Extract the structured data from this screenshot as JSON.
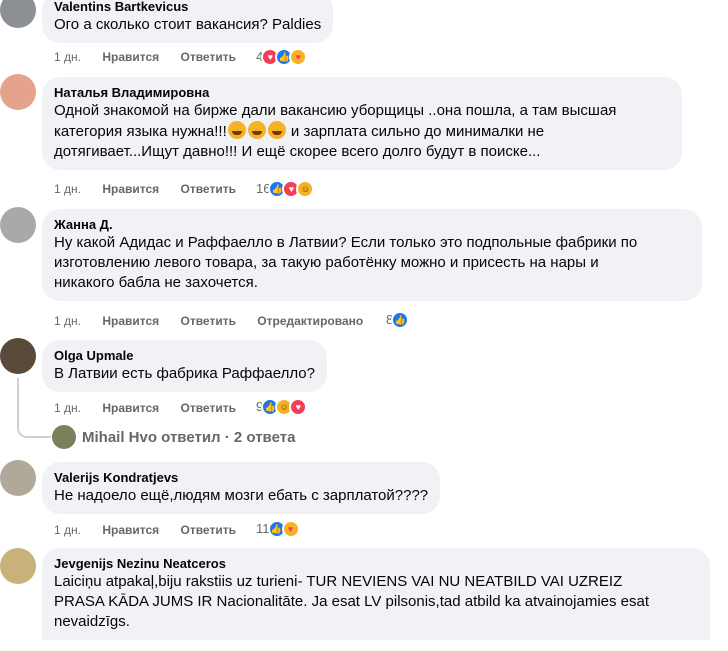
{
  "comments": [
    {
      "author": "Valentins Bartkevicus",
      "text": "Ого а сколько стоит вакансия? Paldies",
      "time": "1 дн.",
      "like": "Нравится",
      "reply": "Ответить",
      "edited": "",
      "count": "4",
      "reactions": [
        "love",
        "like",
        "care"
      ],
      "avatar_color": "#8c8f94"
    },
    {
      "author": "Наталья Владимировна",
      "text_lines": [
        "Одной знакомой на бирже дали вакансию уборщицы ..она пошла, а там высшая",
        "категория языка нужна!!!",
        "и зарплата сильно до минималки не",
        "дотягивает...Ищут давно!!! И ещё скорее всего долго будут в поиске..."
      ],
      "time": "1 дн.",
      "like": "Нравится",
      "reply": "Ответить",
      "count": "16",
      "reactions": [
        "like",
        "love",
        "haha"
      ],
      "avatar_color": "#e5a38c"
    },
    {
      "author": "Жанна Д.",
      "text_lines": [
        "Ну какой Адидас и Раффаелло в Латвии? Если только это подпольные фабрики по",
        "изготовлению левого товара, за такую работёнку можно и присесть на нары и",
        "никакого бабла не захочется."
      ],
      "time": "1 дн.",
      "like": "Нравится",
      "reply": "Ответить",
      "edited": "Отредактировано",
      "count": "8",
      "reactions": [
        "like"
      ],
      "avatar_color": "#a9a9a9"
    },
    {
      "author": "Olga Upmale",
      "text": "В Латвии есть фабрика Раффаелло?",
      "time": "1 дн.",
      "like": "Нравится",
      "reply": "Ответить",
      "count": "9",
      "reactions": [
        "like",
        "haha",
        "love"
      ],
      "avatar_color": "#5a4a3a"
    },
    {
      "author": "Valerijs Kondratjevs",
      "text": "Не надоело ещё,людям мозги ебать с зарплатой????",
      "time": "1 дн.",
      "like": "Нравится",
      "reply": "Ответить",
      "count": "11",
      "reactions": [
        "like",
        "care"
      ],
      "avatar_color": "#b0a898"
    },
    {
      "author": "Jevgenijs Nezinu Neatceros",
      "text_lines": [
        "Laiciņu atpakaļ,biju rakstiis uz turieni- TUR NEVIENS VAI NU NEATBILD VAI UZREIZ",
        "PRASA KĀDA JUMS IR Nacionalitāte. Ja esat LV pilsonis,tad atbild ka atvainojamies esat",
        "nevaidzīgs."
      ],
      "avatar_color": "#c8b27a"
    }
  ],
  "thread_reply": "Mihail Hvo ответил · 2 ответа",
  "colors": {
    "bubble": "#f0f2f5",
    "like": "#1877f2",
    "love": "#f33e58",
    "haha": "#f7b125"
  }
}
